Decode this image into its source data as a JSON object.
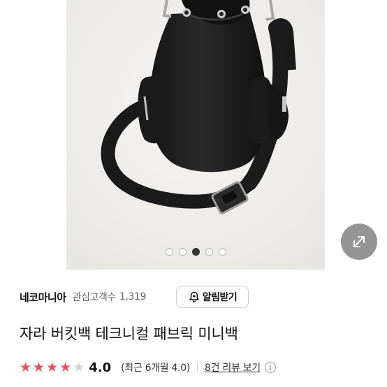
{
  "gallery": {
    "image_count": 5,
    "active_index": 2,
    "expand_icon": "expand-arrows-icon",
    "background": "#efeeec"
  },
  "seller": {
    "name": "네코마니아",
    "followers_label": "관심고객수",
    "followers_count": "1,319",
    "alert_icon": "bell-plus-icon",
    "alert_button_label": "알림받기"
  },
  "product": {
    "title": "자라 버킷백 테크니컬 패브릭 미니백"
  },
  "rating": {
    "stars": 4,
    "max_stars": 5,
    "value": "4.0",
    "recent_label": "(최근 6개월 4.0)",
    "review_link_label": "8건 리뷰 보기",
    "info_icon": "info-icon",
    "star_color": "#e84f57"
  }
}
